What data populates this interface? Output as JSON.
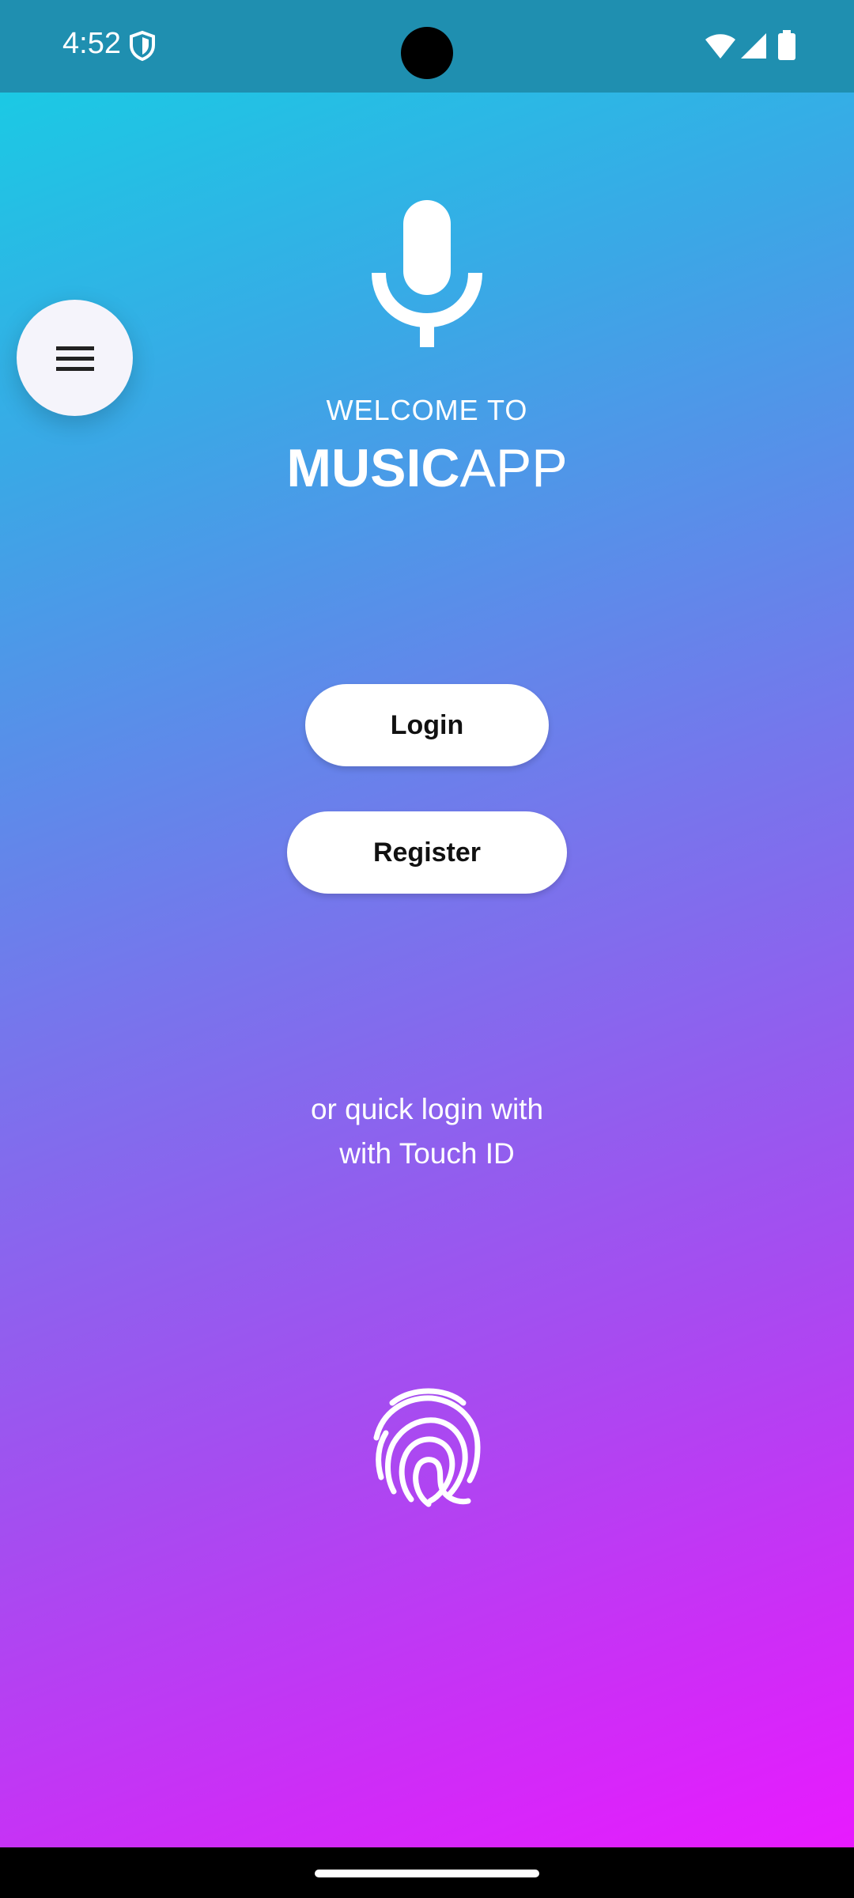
{
  "status_bar": {
    "time": "4:52",
    "icons": [
      "shield-icon",
      "wifi-icon",
      "signal-icon",
      "battery-icon"
    ]
  },
  "menu": {
    "icon": "hamburger-menu-icon"
  },
  "hero": {
    "icon": "microphone-icon",
    "welcome": "WELCOME TO",
    "app_name_bold": "MUSIC",
    "app_name_light": "APP"
  },
  "buttons": {
    "login": "Login",
    "register": "Register"
  },
  "quick_login": {
    "line1": "or quick login with",
    "line2": "with Touch ID",
    "icon": "fingerprint-icon"
  },
  "colors": {
    "gradient_top": "#14d1e3",
    "gradient_mid": "#7676ec",
    "gradient_bottom": "#e81aff",
    "status_bar": "#1f8fb0"
  }
}
